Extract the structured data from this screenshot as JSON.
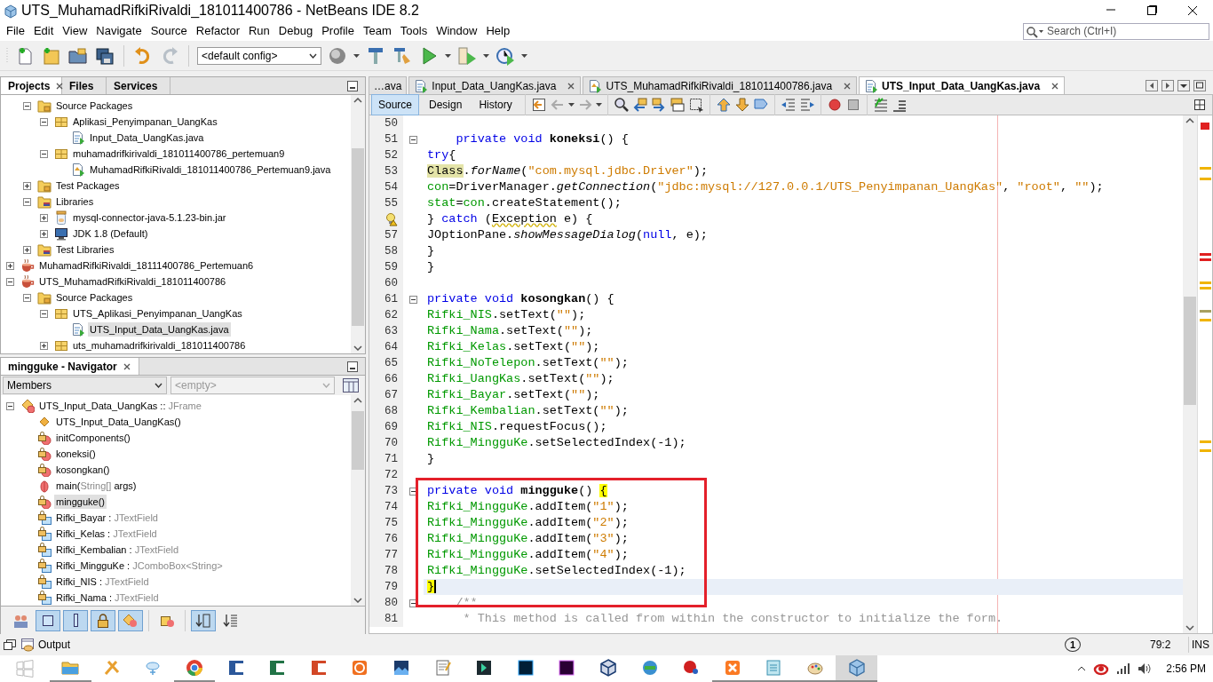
{
  "window": {
    "title": "UTS_MuhamadRifkiRivaldi_181011400786 - NetBeans IDE 8.2"
  },
  "menu": [
    "File",
    "Edit",
    "View",
    "Navigate",
    "Source",
    "Refactor",
    "Run",
    "Debug",
    "Profile",
    "Team",
    "Tools",
    "Window",
    "Help"
  ],
  "search": {
    "placeholder": "Search (Ctrl+I)"
  },
  "toolbar": {
    "config": "<default config>"
  },
  "projects_panel": {
    "tabs": [
      {
        "label": "Projects",
        "selected": true
      },
      {
        "label": "Files",
        "selected": false
      },
      {
        "label": "Services",
        "selected": false
      }
    ],
    "tree": {
      "partial_children": [
        {
          "label": "Source Packages",
          "kind": "sources",
          "expanded": true,
          "selected": false,
          "children": [
            {
              "label": "Aplikasi_Penyimpanan_UangKas",
              "kind": "package",
              "expanded": true,
              "selected": false,
              "children": [
                {
                  "label": "Input_Data_UangKas.java",
                  "kind": "form",
                  "selected": false
                }
              ]
            },
            {
              "label": "muhamadrifkirivaldi_181011400786_pertemuan9",
              "kind": "package",
              "expanded": true,
              "selected": false,
              "children": [
                {
                  "label": "MuhamadRifkiRivaldi_181011400786_Pertemuan9.java",
                  "kind": "main-class",
                  "selected": false
                }
              ]
            }
          ]
        },
        {
          "label": "Test Packages",
          "kind": "sources",
          "expanded": false,
          "selected": false
        },
        {
          "label": "Libraries",
          "kind": "libraries",
          "expanded": true,
          "selected": false,
          "children": [
            {
              "label": "mysql-connector-java-5.1.23-bin.jar",
              "kind": "jar",
              "expanded": false,
              "selected": false
            },
            {
              "label": "JDK 1.8 (Default)",
              "kind": "jdk",
              "expanded": false,
              "selected": false
            }
          ]
        },
        {
          "label": "Test Libraries",
          "kind": "libraries",
          "expanded": false,
          "selected": false
        }
      ],
      "items": [
        {
          "label": "MuhamadRifkiRivaldi_18111400786_Pertemuan6",
          "kind": "project",
          "expanded": false,
          "selected": false
        },
        {
          "label": "UTS_MuhamadRifkiRivaldi_181011400786",
          "kind": "project",
          "expanded": true,
          "selected": false,
          "children": [
            {
              "label": "Source Packages",
              "kind": "sources",
              "expanded": true,
              "selected": false,
              "children": [
                {
                  "label": "UTS_Aplikasi_Penyimpanan_UangKas",
                  "kind": "package",
                  "expanded": true,
                  "selected": false,
                  "children": [
                    {
                      "label": "UTS_Input_Data_UangKas.java",
                      "kind": "form",
                      "selected": true
                    }
                  ]
                },
                {
                  "label": "uts_muhamadrifkirivaldi_181011400786",
                  "kind": "package",
                  "expanded": false,
                  "selected": false
                }
              ]
            }
          ]
        }
      ]
    }
  },
  "navigator": {
    "title": "mingguke - Navigator",
    "filter": {
      "value": "Members",
      "disabled": false
    },
    "scope": {
      "value": "<empty>",
      "disabled": true
    },
    "members": [
      {
        "kind": "class",
        "expanded": true,
        "selected": false,
        "segments": [
          {
            "kind": "name",
            "text": "UTS_Input_Data_UangKas :: "
          },
          {
            "kind": "type",
            "text": "JFrame"
          }
        ],
        "children": [
          {
            "kind": "constructor",
            "selected": false,
            "segments": [
              {
                "kind": "name",
                "text": "UTS_Input_Data_UangKas()"
              }
            ]
          },
          {
            "kind": "private-method",
            "selected": false,
            "segments": [
              {
                "kind": "name",
                "text": "initComponents()"
              }
            ]
          },
          {
            "kind": "private-method",
            "selected": false,
            "segments": [
              {
                "kind": "name",
                "text": "koneksi()"
              }
            ]
          },
          {
            "kind": "private-method",
            "selected": false,
            "segments": [
              {
                "kind": "name",
                "text": "kosongkan()"
              }
            ]
          },
          {
            "kind": "static-method",
            "selected": false,
            "segments": [
              {
                "kind": "name",
                "text": "main("
              },
              {
                "kind": "type",
                "text": "String[]"
              },
              {
                "kind": "name",
                "text": " args)"
              }
            ]
          },
          {
            "kind": "private-method",
            "selected": true,
            "segments": [
              {
                "kind": "name",
                "text": "mingguke()"
              }
            ]
          },
          {
            "kind": "private-field",
            "selected": false,
            "segments": [
              {
                "kind": "name",
                "text": "Rifki_Bayar : "
              },
              {
                "kind": "type",
                "text": "JTextField"
              }
            ]
          },
          {
            "kind": "private-field",
            "selected": false,
            "segments": [
              {
                "kind": "name",
                "text": "Rifki_Kelas : "
              },
              {
                "kind": "type",
                "text": "JTextField"
              }
            ]
          },
          {
            "kind": "private-field",
            "selected": false,
            "segments": [
              {
                "kind": "name",
                "text": "Rifki_Kembalian : "
              },
              {
                "kind": "type",
                "text": "JTextField"
              }
            ]
          },
          {
            "kind": "private-field",
            "selected": false,
            "segments": [
              {
                "kind": "name",
                "text": "Rifki_MingguKe : "
              },
              {
                "kind": "type",
                "text": "JComboBox<String>"
              }
            ]
          },
          {
            "kind": "private-field",
            "selected": false,
            "segments": [
              {
                "kind": "name",
                "text": "Rifki_NIS : "
              },
              {
                "kind": "type",
                "text": "JTextField"
              }
            ]
          },
          {
            "kind": "private-field",
            "selected": false,
            "segments": [
              {
                "kind": "name",
                "text": "Rifki_Nama : "
              },
              {
                "kind": "type",
                "text": "JTextField"
              }
            ]
          }
        ]
      }
    ],
    "buttons": [
      {
        "kind": "inherited",
        "pressed": false
      },
      {
        "kind": "fields",
        "pressed": true
      },
      {
        "kind": "static",
        "pressed": true
      },
      {
        "kind": "non-public",
        "pressed": true
      },
      {
        "kind": "local-classes",
        "pressed": true
      },
      {
        "kind": "fqn",
        "pressed": false
      },
      {
        "kind": "sort-name",
        "pressed": true
      },
      {
        "kind": "sort-source",
        "pressed": false
      }
    ]
  },
  "editor": {
    "tabs": [
      {
        "label": "…ava",
        "kind": "overflow",
        "selected": false
      },
      {
        "label": "Input_Data_UangKas.java",
        "kind": "form",
        "selected": false
      },
      {
        "label": "UTS_MuhamadRifkiRivaldi_181011400786.java",
        "kind": "main-class",
        "selected": false
      },
      {
        "label": "UTS_Input_Data_UangKas.java",
        "kind": "form",
        "selected": true
      }
    ],
    "views": [
      {
        "label": "Source",
        "selected": true
      },
      {
        "label": "Design",
        "selected": false
      },
      {
        "label": "History",
        "selected": false
      }
    ],
    "lines": [
      {
        "number": "50",
        "fold": false,
        "current": false
      },
      {
        "number": "51",
        "fold": true,
        "current": false,
        "segments": [
          {
            "kind": "kw",
            "text": "    private void"
          },
          {
            "kind": "decl",
            "text": " koneksi"
          },
          {
            "kind": "plain",
            "text": "() {"
          }
        ]
      },
      {
        "number": "52",
        "fold": false,
        "current": false,
        "segments": [
          {
            "kind": "kw",
            "text": "try"
          },
          {
            "kind": "plain",
            "text": "{"
          }
        ]
      },
      {
        "number": "53",
        "fold": false,
        "current": false,
        "segments": [
          {
            "kind": "mark",
            "text": "Class"
          },
          {
            "kind": "plain",
            "text": "."
          },
          {
            "kind": "italic",
            "text": "forName"
          },
          {
            "kind": "plain",
            "text": "("
          },
          {
            "kind": "str",
            "text": "\"com.mysql.jdbc.Driver\""
          },
          {
            "kind": "plain",
            "text": ");"
          }
        ]
      },
      {
        "number": "54",
        "fold": false,
        "current": false,
        "segments": [
          {
            "kind": "field",
            "text": "con"
          },
          {
            "kind": "plain",
            "text": "=DriverManager."
          },
          {
            "kind": "italic",
            "text": "getConnection"
          },
          {
            "kind": "plain",
            "text": "("
          },
          {
            "kind": "str",
            "text": "\"jdbc:mysql://127.0.0.1/UTS_Penyimpanan_UangKas\""
          },
          {
            "kind": "plain",
            "text": ", "
          },
          {
            "kind": "str",
            "text": "\"root\""
          },
          {
            "kind": "plain",
            "text": ", "
          },
          {
            "kind": "str",
            "text": "\"\""
          },
          {
            "kind": "plain",
            "text": ");"
          }
        ]
      },
      {
        "number": "55",
        "fold": false,
        "current": false,
        "segments": [
          {
            "kind": "field",
            "text": "stat"
          },
          {
            "kind": "plain",
            "text": "="
          },
          {
            "kind": "field",
            "text": "con"
          },
          {
            "kind": "plain",
            "text": ".createStatement();"
          }
        ]
      },
      {
        "hint": true,
        "fold": false,
        "current": false,
        "segments": [
          {
            "kind": "plain",
            "text": "} "
          },
          {
            "kind": "kw",
            "text": "catch"
          },
          {
            "kind": "plain",
            "text": " ("
          },
          {
            "kind": "warn",
            "text": "Exception"
          },
          {
            "kind": "plain",
            "text": " e) {"
          }
        ]
      },
      {
        "number": "57",
        "fold": false,
        "current": false,
        "segments": [
          {
            "kind": "plain",
            "text": "JOptionPane."
          },
          {
            "kind": "italic",
            "text": "showMessageDialog"
          },
          {
            "kind": "plain",
            "text": "("
          },
          {
            "kind": "kw",
            "text": "null"
          },
          {
            "kind": "plain",
            "text": ", e);"
          }
        ]
      },
      {
        "number": "58",
        "fold": false,
        "current": false,
        "segments": [
          {
            "kind": "plain",
            "text": "}"
          }
        ]
      },
      {
        "number": "59",
        "fold": false,
        "current": false,
        "segments": [
          {
            "kind": "plain",
            "text": "}"
          }
        ]
      },
      {
        "number": "60",
        "fold": false,
        "current": false
      },
      {
        "number": "61",
        "fold": true,
        "current": false,
        "segments": [
          {
            "kind": "kw",
            "text": "private void"
          },
          {
            "kind": "decl",
            "text": " kosongkan"
          },
          {
            "kind": "plain",
            "text": "() {"
          }
        ]
      },
      {
        "number": "62",
        "fold": false,
        "current": false,
        "segments": [
          {
            "kind": "field",
            "text": "Rifki_NIS"
          },
          {
            "kind": "plain",
            "text": ".setText("
          },
          {
            "kind": "str",
            "text": "\"\""
          },
          {
            "kind": "plain",
            "text": ");"
          }
        ]
      },
      {
        "number": "63",
        "fold": false,
        "current": false,
        "segments": [
          {
            "kind": "field",
            "text": "Rifki_Nama"
          },
          {
            "kind": "plain",
            "text": ".setText("
          },
          {
            "kind": "str",
            "text": "\"\""
          },
          {
            "kind": "plain",
            "text": ");"
          }
        ]
      },
      {
        "number": "64",
        "fold": false,
        "current": false,
        "segments": [
          {
            "kind": "field",
            "text": "Rifki_Kelas"
          },
          {
            "kind": "plain",
            "text": ".setText("
          },
          {
            "kind": "str",
            "text": "\"\""
          },
          {
            "kind": "plain",
            "text": ");"
          }
        ]
      },
      {
        "number": "65",
        "fold": false,
        "current": false,
        "segments": [
          {
            "kind": "field",
            "text": "Rifki_NoTelepon"
          },
          {
            "kind": "plain",
            "text": ".setText("
          },
          {
            "kind": "str",
            "text": "\"\""
          },
          {
            "kind": "plain",
            "text": ");"
          }
        ]
      },
      {
        "number": "66",
        "fold": false,
        "current": false,
        "segments": [
          {
            "kind": "field",
            "text": "Rifki_UangKas"
          },
          {
            "kind": "plain",
            "text": ".setText("
          },
          {
            "kind": "str",
            "text": "\"\""
          },
          {
            "kind": "plain",
            "text": ");"
          }
        ]
      },
      {
        "number": "67",
        "fold": false,
        "current": false,
        "segments": [
          {
            "kind": "field",
            "text": "Rifki_Bayar"
          },
          {
            "kind": "plain",
            "text": ".setText("
          },
          {
            "kind": "str",
            "text": "\"\""
          },
          {
            "kind": "plain",
            "text": ");"
          }
        ]
      },
      {
        "number": "68",
        "fold": false,
        "current": false,
        "segments": [
          {
            "kind": "field",
            "text": "Rifki_Kembalian"
          },
          {
            "kind": "plain",
            "text": ".setText("
          },
          {
            "kind": "str",
            "text": "\"\""
          },
          {
            "kind": "plain",
            "text": ");"
          }
        ]
      },
      {
        "number": "69",
        "fold": false,
        "current": false,
        "segments": [
          {
            "kind": "field",
            "text": "Rifki_NIS"
          },
          {
            "kind": "plain",
            "text": ".requestFocus();"
          }
        ]
      },
      {
        "number": "70",
        "fold": false,
        "current": false,
        "segments": [
          {
            "kind": "field",
            "text": "Rifki_MingguKe"
          },
          {
            "kind": "plain",
            "text": ".setSelectedIndex(-1);"
          }
        ]
      },
      {
        "number": "71",
        "fold": false,
        "current": false,
        "segments": [
          {
            "kind": "plain",
            "text": "}"
          }
        ]
      },
      {
        "number": "72",
        "fold": false,
        "current": false
      },
      {
        "kind": "annotation-box",
        "lines": [
          {
            "number": "73",
            "fold": true,
            "current": false,
            "segments": [
              {
                "kind": "kw",
                "text": "private void"
              },
              {
                "kind": "decl",
                "text": " mingguke"
              },
              {
                "kind": "plain",
                "text": "() "
              },
              {
                "kind": "match",
                "text": "{"
              }
            ]
          },
          {
            "number": "74",
            "fold": false,
            "current": false,
            "segments": [
              {
                "kind": "field",
                "text": "Rifki_MingguKe"
              },
              {
                "kind": "plain",
                "text": ".addItem("
              },
              {
                "kind": "str",
                "text": "\"1\""
              },
              {
                "kind": "plain",
                "text": ");"
              }
            ]
          },
          {
            "number": "75",
            "fold": false,
            "current": false,
            "segments": [
              {
                "kind": "field",
                "text": "Rifki_MingguKe"
              },
              {
                "kind": "plain",
                "text": ".addItem("
              },
              {
                "kind": "str",
                "text": "\"2\""
              },
              {
                "kind": "plain",
                "text": ");"
              }
            ]
          },
          {
            "number": "76",
            "fold": false,
            "current": false,
            "segments": [
              {
                "kind": "field",
                "text": "Rifki_MingguKe"
              },
              {
                "kind": "plain",
                "text": ".addItem("
              },
              {
                "kind": "str",
                "text": "\"3\""
              },
              {
                "kind": "plain",
                "text": ");"
              }
            ]
          },
          {
            "number": "77",
            "fold": false,
            "current": false,
            "segments": [
              {
                "kind": "field",
                "text": "Rifki_MingguKe"
              },
              {
                "kind": "plain",
                "text": ".addItem("
              },
              {
                "kind": "str",
                "text": "\"4\""
              },
              {
                "kind": "plain",
                "text": ");"
              }
            ]
          },
          {
            "number": "78",
            "fold": false,
            "current": false,
            "segments": [
              {
                "kind": "field",
                "text": "Rifki_MingguKe"
              },
              {
                "kind": "plain",
                "text": ".setSelectedIndex(-1);"
              }
            ]
          },
          {
            "number": "79",
            "fold": false,
            "current": true,
            "segments": [
              {
                "kind": "match",
                "text": "}"
              }
            ]
          }
        ]
      },
      {
        "number": "80",
        "fold": true,
        "current": false,
        "segments": [
          {
            "kind": "comment",
            "text": "    /**"
          }
        ]
      },
      {
        "number": "81",
        "fold": false,
        "current": false,
        "segments": [
          {
            "kind": "comment",
            "text": "     * This method is called from within the constructor to initialize the form."
          }
        ]
      }
    ]
  },
  "output": {
    "label": "Output"
  },
  "status_bar": {
    "notifications": "1",
    "position": "79:2",
    "mode": "INS"
  },
  "taskbar": {
    "apps": [
      {
        "kind": "folder",
        "running": true,
        "active": false
      },
      {
        "kind": "tools",
        "running": false,
        "active": false
      },
      {
        "kind": "cloud",
        "running": false,
        "active": false
      },
      {
        "kind": "browser",
        "running": true,
        "active": false
      },
      {
        "kind": "tile-blue",
        "running": false,
        "active": false
      },
      {
        "kind": "tile-green",
        "running": false,
        "active": false
      },
      {
        "kind": "tile-orange",
        "running": false,
        "active": false
      },
      {
        "kind": "ring",
        "running": false,
        "active": false
      },
      {
        "kind": "photo",
        "running": false,
        "active": false
      },
      {
        "kind": "notepad",
        "running": false,
        "active": false
      },
      {
        "kind": "video",
        "running": false,
        "active": false
      },
      {
        "kind": "tile-navy",
        "running": false,
        "active": false
      },
      {
        "kind": "tile-purple",
        "running": false,
        "active": false
      },
      {
        "kind": "cube",
        "running": false,
        "active": false
      },
      {
        "kind": "globe",
        "running": false,
        "active": false
      },
      {
        "kind": "ball",
        "running": false,
        "active": false
      },
      {
        "kind": "xampp",
        "running": true,
        "active": false
      },
      {
        "kind": "notebook",
        "running": true,
        "active": false
      },
      {
        "kind": "palette",
        "running": true,
        "active": false
      },
      {
        "kind": "netbeans",
        "running": true,
        "active": true
      }
    ],
    "clock": "2:56 PM"
  }
}
